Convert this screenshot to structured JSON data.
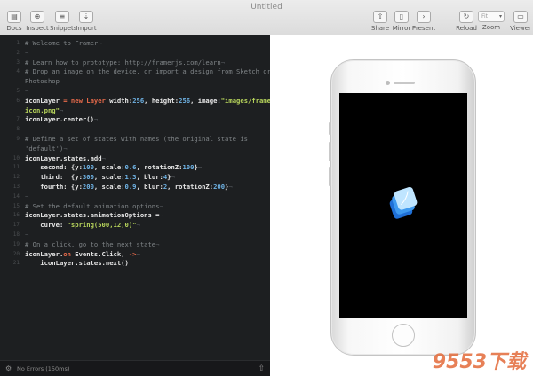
{
  "window": {
    "title": "Untitled"
  },
  "toolbar": {
    "left": [
      {
        "label": "Docs",
        "icon": "docs-icon",
        "glyph": "▤"
      },
      {
        "label": "Inspect",
        "icon": "inspect-icon",
        "glyph": "⊕"
      },
      {
        "label": "Snippets",
        "icon": "snippets-icon",
        "glyph": "≡"
      },
      {
        "label": "Import",
        "icon": "import-icon",
        "glyph": "⇣"
      }
    ],
    "right": [
      {
        "label": "Share",
        "icon": "share-icon",
        "glyph": "⇧"
      },
      {
        "label": "Mirror",
        "icon": "mirror-icon",
        "glyph": "▯"
      },
      {
        "label": "Present",
        "icon": "present-icon",
        "glyph": "›"
      },
      {
        "label": "Reload",
        "icon": "reload-icon",
        "glyph": "↻"
      },
      {
        "label": "Zoom",
        "value": "Fit"
      },
      {
        "label": "Viewer",
        "icon": "viewer-icon",
        "glyph": "▭"
      }
    ]
  },
  "editor": {
    "lines": [
      {
        "n": "1",
        "parts": [
          {
            "t": "# Welcome to Framer",
            "c": "comment"
          },
          {
            "t": "¬",
            "c": "ws"
          }
        ]
      },
      {
        "n": "2",
        "parts": [
          {
            "t": "¬",
            "c": "ws"
          }
        ]
      },
      {
        "n": "3",
        "parts": [
          {
            "t": "# Learn how to prototype: http://framerjs.com/learn",
            "c": "comment"
          },
          {
            "t": "¬",
            "c": "ws"
          }
        ]
      },
      {
        "n": "4",
        "parts": [
          {
            "t": "# Drop an image on the device, or import a design from Sketch or",
            "c": "comment"
          }
        ]
      },
      {
        "n": "",
        "parts": [
          {
            "t": "Photoshop",
            "c": "comment"
          }
        ]
      },
      {
        "n": "5",
        "parts": [
          {
            "t": "¬",
            "c": "ws"
          }
        ]
      },
      {
        "n": "6",
        "parts": [
          {
            "t": "iconLayer ",
            "c": "plain"
          },
          {
            "t": "= new Layer ",
            "c": "kw"
          },
          {
            "t": "width:",
            "c": "plain"
          },
          {
            "t": "256",
            "c": "num"
          },
          {
            "t": ", height:",
            "c": "plain"
          },
          {
            "t": "256",
            "c": "num"
          },
          {
            "t": ", image:",
            "c": "plain"
          },
          {
            "t": "\"images/framer-",
            "c": "str"
          }
        ]
      },
      {
        "n": "",
        "parts": [
          {
            "t": "icon.png\"",
            "c": "str"
          },
          {
            "t": "¬",
            "c": "ws"
          }
        ]
      },
      {
        "n": "7",
        "parts": [
          {
            "t": "iconLayer.center()",
            "c": "plain"
          },
          {
            "t": "¬",
            "c": "ws"
          }
        ]
      },
      {
        "n": "8",
        "parts": [
          {
            "t": "¬",
            "c": "ws"
          }
        ]
      },
      {
        "n": "9",
        "parts": [
          {
            "t": "# Define a set of states with names (the original state is",
            "c": "comment"
          }
        ]
      },
      {
        "n": "",
        "parts": [
          {
            "t": "'default')",
            "c": "comment"
          },
          {
            "t": "¬",
            "c": "ws"
          }
        ]
      },
      {
        "n": "10",
        "parts": [
          {
            "t": "iconLayer.states.add",
            "c": "plain"
          },
          {
            "t": "¬",
            "c": "ws"
          }
        ]
      },
      {
        "n": "11",
        "parts": [
          {
            "t": "    second: {y:",
            "c": "plain"
          },
          {
            "t": "100",
            "c": "num"
          },
          {
            "t": ", scale:",
            "c": "plain"
          },
          {
            "t": "0.6",
            "c": "num"
          },
          {
            "t": ", rotationZ:",
            "c": "plain"
          },
          {
            "t": "100",
            "c": "num"
          },
          {
            "t": "}",
            "c": "plain"
          },
          {
            "t": "¬",
            "c": "ws"
          }
        ]
      },
      {
        "n": "12",
        "parts": [
          {
            "t": "    third:  {y:",
            "c": "plain"
          },
          {
            "t": "300",
            "c": "num"
          },
          {
            "t": ", scale:",
            "c": "plain"
          },
          {
            "t": "1.3",
            "c": "num"
          },
          {
            "t": ", blur:",
            "c": "plain"
          },
          {
            "t": "4",
            "c": "num"
          },
          {
            "t": "}",
            "c": "plain"
          },
          {
            "t": "¬",
            "c": "ws"
          }
        ]
      },
      {
        "n": "13",
        "parts": [
          {
            "t": "    fourth: {y:",
            "c": "plain"
          },
          {
            "t": "200",
            "c": "num"
          },
          {
            "t": ", scale:",
            "c": "plain"
          },
          {
            "t": "0.9",
            "c": "num"
          },
          {
            "t": ", blur:",
            "c": "plain"
          },
          {
            "t": "2",
            "c": "num"
          },
          {
            "t": ", rotationZ:",
            "c": "plain"
          },
          {
            "t": "200",
            "c": "num"
          },
          {
            "t": "}",
            "c": "plain"
          },
          {
            "t": "¬",
            "c": "ws"
          }
        ]
      },
      {
        "n": "14",
        "parts": [
          {
            "t": "¬",
            "c": "ws"
          }
        ]
      },
      {
        "n": "15",
        "parts": [
          {
            "t": "# Set the default animation options",
            "c": "comment"
          },
          {
            "t": "¬",
            "c": "ws"
          }
        ]
      },
      {
        "n": "16",
        "parts": [
          {
            "t": "iconLayer.states.animationOptions =",
            "c": "plain"
          },
          {
            "t": "¬",
            "c": "ws"
          }
        ]
      },
      {
        "n": "17",
        "parts": [
          {
            "t": "    curve: ",
            "c": "plain"
          },
          {
            "t": "\"spring(500,12,0)\"",
            "c": "str"
          },
          {
            "t": "¬",
            "c": "ws"
          }
        ]
      },
      {
        "n": "18",
        "parts": [
          {
            "t": "¬",
            "c": "ws"
          }
        ]
      },
      {
        "n": "19",
        "parts": [
          {
            "t": "# On a click, go to the next state",
            "c": "comment"
          },
          {
            "t": "¬",
            "c": "ws"
          }
        ]
      },
      {
        "n": "20",
        "parts": [
          {
            "t": "iconLayer.",
            "c": "plain"
          },
          {
            "t": "on ",
            "c": "kw"
          },
          {
            "t": "Events.Click, ",
            "c": "plain"
          },
          {
            "t": "->",
            "c": "kw"
          },
          {
            "t": "¬",
            "c": "ws"
          }
        ]
      },
      {
        "n": "21",
        "parts": [
          {
            "t": "    iconLayer.states.next()",
            "c": "plain"
          }
        ]
      }
    ],
    "status": "No Errors (150ms)"
  },
  "watermark": "9553下载",
  "colors": {
    "editor_bg": "#1d1f21",
    "comment": "#7f8487",
    "keyword": "#e76a4a",
    "number": "#6fb3e5",
    "string": "#b6d35b",
    "screen": "#000000"
  }
}
